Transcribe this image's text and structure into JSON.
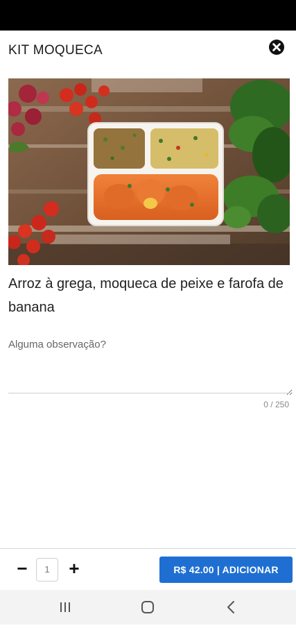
{
  "header": {
    "title": "KIT MOQUECA",
    "close_icon": "close-circle-icon"
  },
  "product": {
    "description": "Arroz à grega, moqueca de peixe e farofa de banana"
  },
  "observation": {
    "placeholder": "Alguma observação?",
    "value": "",
    "counter": "0 / 250"
  },
  "footer": {
    "minus_label": "−",
    "quantity": "1",
    "plus_label": "+",
    "add_button_label": "R$ 42.00 | ADICIONAR",
    "accent_color": "#1e6fd1"
  },
  "navigation": {
    "recent_icon": "recent-apps-icon",
    "home_icon": "home-icon",
    "back_icon": "back-icon"
  }
}
